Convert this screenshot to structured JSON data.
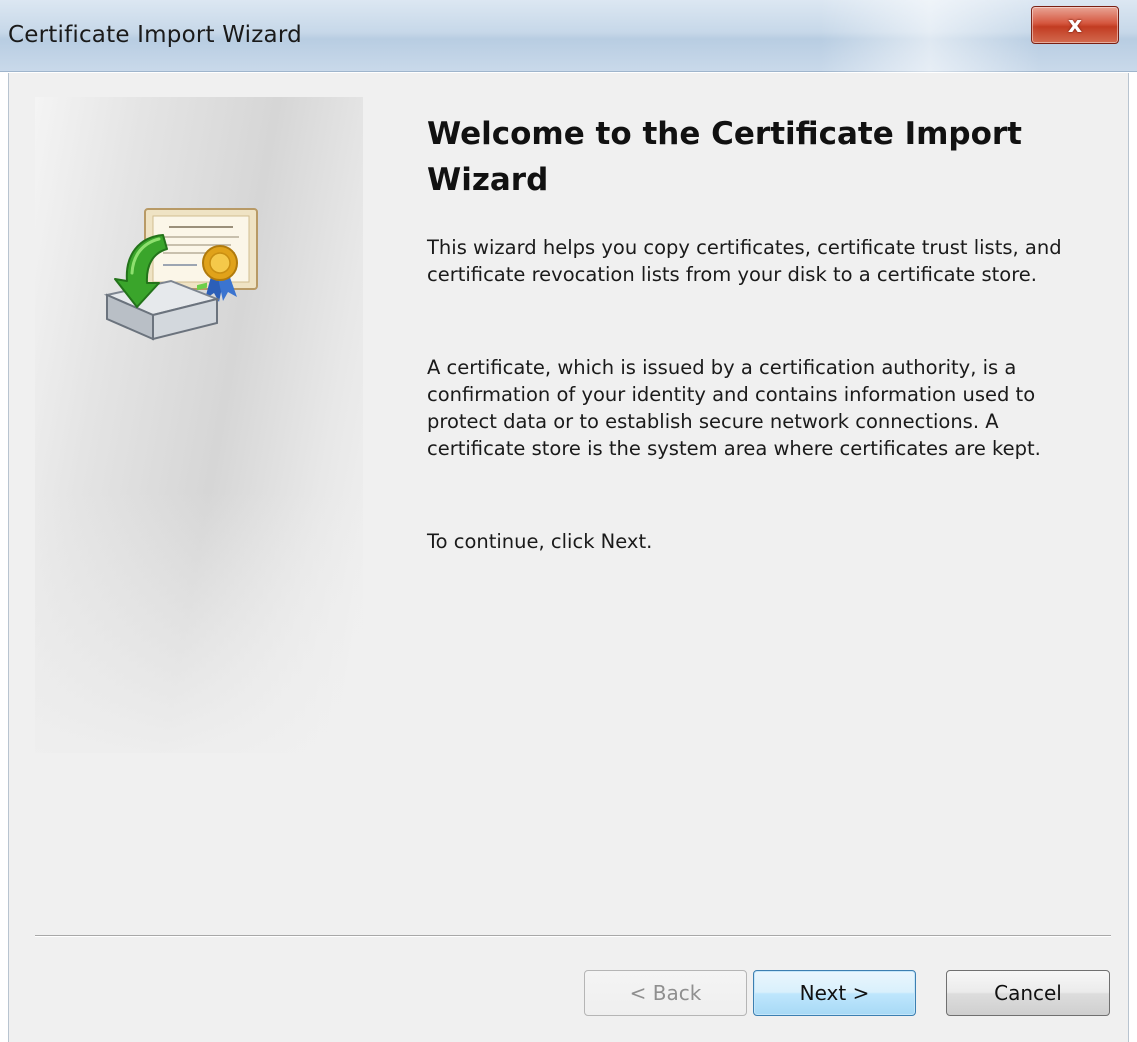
{
  "window": {
    "title": "Certificate Import Wizard",
    "close_glyph": "x"
  },
  "content": {
    "heading": "Welcome to the Certificate Import Wizard",
    "paragraph_1": "This wizard helps you copy certificates, certificate trust lists, and certificate revocation lists from your disk to a certificate store.",
    "paragraph_2": "A certificate, which is issued by a certification authority, is a confirmation of your identity and contains information used to protect data or to establish secure network connections. A certificate store is the system area where certificates are kept.",
    "paragraph_3": "To continue, click Next."
  },
  "illustration": {
    "icon": "certificate-import-icon"
  },
  "buttons": {
    "back_label": "< Back",
    "back_enabled": false,
    "next_label": "Next >",
    "cancel_label": "Cancel"
  },
  "colors": {
    "close_button": "#c23c22",
    "default_button_border": "#3c7fb1",
    "arrow_green": "#3aa52b",
    "seal_gold": "#e0a21a",
    "ribbon_blue": "#2c5fb8"
  }
}
